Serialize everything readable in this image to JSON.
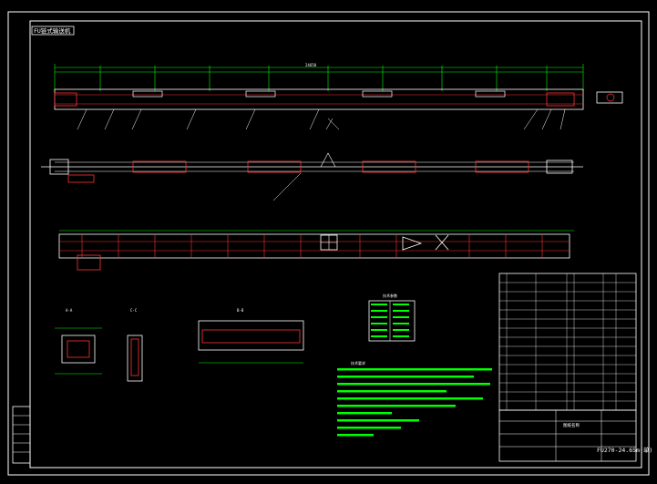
{
  "drawing": {
    "header_tag": "FU链式输送机",
    "title_block_text": "FU270-24.65m(单)",
    "company_cell": "图纸名称",
    "view_labels": {
      "section_a": "A-A",
      "section_c": "C-C",
      "section_b": "B-B",
      "table_title": "技术参数"
    },
    "part_numbers_top": [
      "1",
      "2",
      "3",
      "4",
      "5",
      "6",
      "7",
      "8",
      "9",
      "10",
      "11"
    ],
    "overall_length": "24650",
    "notes_heading": "技术要求"
  },
  "colors": {
    "background": "#000000",
    "frame": "#ffffff",
    "outline": "#ffffff",
    "cut": "#ff3333",
    "dimension": "#00ff00",
    "text": "#ffffff"
  }
}
